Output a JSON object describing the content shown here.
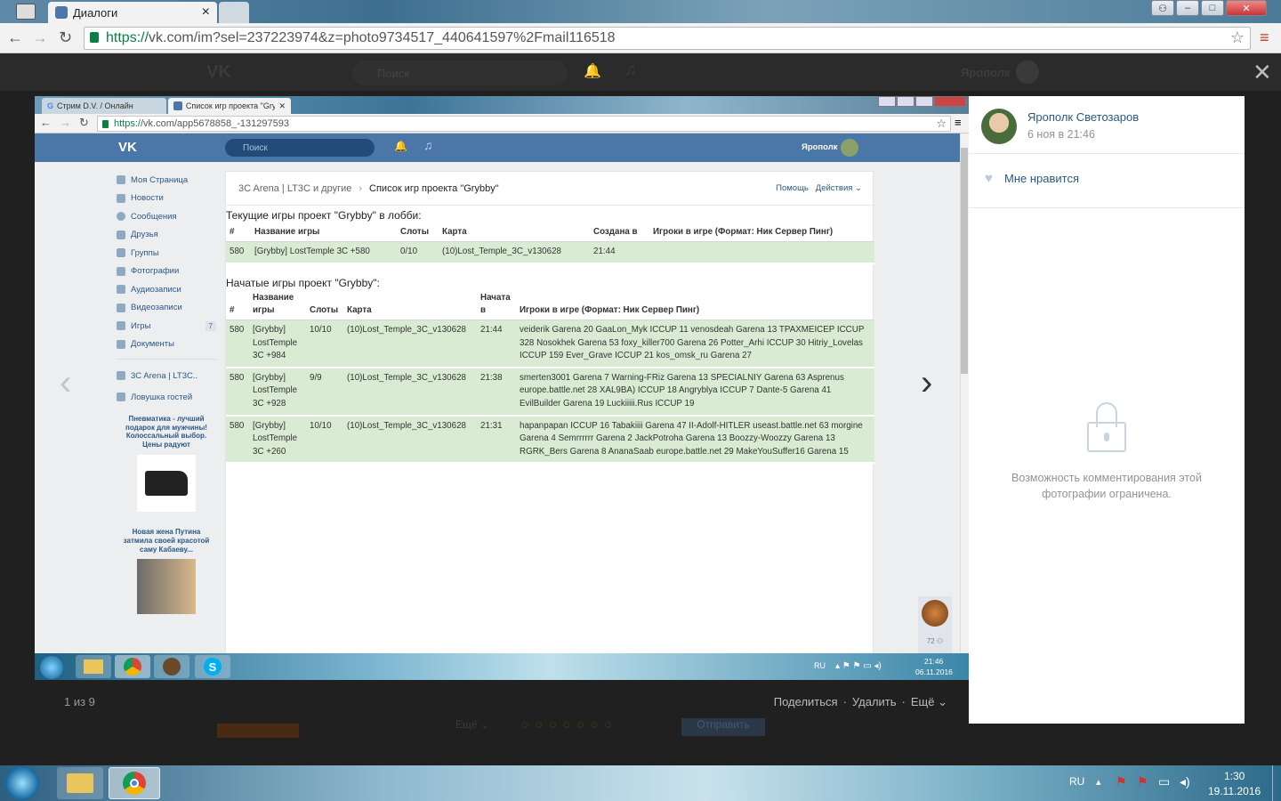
{
  "outer_browser": {
    "tab_active_title": "Диалоги",
    "tab_close": "×",
    "url_scheme": "https://",
    "url_rest": "vk.com/im?sel=237223974&z=photo9734517_440641597%2Fmail116518",
    "window_buttons": [
      "–",
      "□",
      "✕"
    ]
  },
  "vk_dark_header": {
    "search_placeholder": "Поиск",
    "user_name": "Ярополк"
  },
  "inner_screenshot": {
    "tabs": [
      {
        "title": "Стрим D.V. / Онлайн"
      },
      {
        "title": "Список игр проекта \"Gry"
      }
    ],
    "url_scheme": "https://",
    "url_rest": "vk.com/app5678858_-131297593",
    "search_placeholder": "Поиск",
    "user_name": "Ярополк",
    "sidebar": [
      {
        "label": "Моя Страница"
      },
      {
        "label": "Новости"
      },
      {
        "label": "Сообщения"
      },
      {
        "label": "Друзья"
      },
      {
        "label": "Группы"
      },
      {
        "label": "Фотографии"
      },
      {
        "label": "Аудиозаписи"
      },
      {
        "label": "Видеозаписи"
      },
      {
        "label": "Игры",
        "badge": "7"
      },
      {
        "label": "Документы"
      }
    ],
    "sidebar_extra": [
      {
        "label": "3C Arena | LT3C.."
      },
      {
        "label": "Ловушка гостей"
      }
    ],
    "ad1": "Пневматика - лучший подарок для мужчины! Колоссальный выбор. Цены радуют",
    "ad2": "Новая жена Путина затмила своей красотой саму Кабаеву...",
    "breadcrumb": {
      "group": "3C Arena | LT3C и другие",
      "sep": "›",
      "page": "Список игр проекта \"Grybby\"",
      "help": "Помощь",
      "actions": "Действия ⌄"
    },
    "lobby": {
      "title": "Текущие игры проект \"Grybby\" в лобби:",
      "headers": [
        "#",
        "Название игры",
        "Слоты",
        "Карта",
        "Создана в",
        "Игроки в игре (Формат: Ник Сервер Пинг)"
      ],
      "rows": [
        [
          "580",
          "[Grybby] LostTemple 3C +580",
          "0/10",
          "(10)Lost_Temple_3C_v130628",
          "21:44",
          ""
        ]
      ]
    },
    "started": {
      "title": "Начатые игры проект \"Grybby\":",
      "headers": [
        "#",
        "Название игры",
        "Слоты",
        "Карта",
        "Начата в",
        "Игроки в игре (Формат: Ник Сервер Пинг)"
      ],
      "rows": [
        [
          "580",
          "[Grybby] LostTemple 3C +984",
          "10/10",
          "(10)Lost_Temple_3C_v130628",
          "21:44",
          "veiderik Garena 20 GaaLon_Myk ICCUP 11 venosdeah Garena 13 TPAXMEICEP ICCUP 328 Nosokhek Garena 53 foxy_killer700 Garena 26 Potter_Arhi ICCUP 30 Hitriy_Lovelas ICCUP 159 Ever_Grave ICCUP 21 kos_omsk_ru Garena 27"
        ],
        [
          "580",
          "[Grybby] LostTemple 3C +928",
          "9/9",
          "(10)Lost_Temple_3C_v130628",
          "21:38",
          "smerten3001 Garena 7 Warning-FRiz Garena 13 SPECIALNIY Garena 63 Asprenus europe.battle.net 28 XAL9BA) ICCUP 18 Angryblya ICCUP 7 Dante-5 Garena 41 EvilBuilder Garena 19 Luckiiiii.Rus ICCUP 19"
        ],
        [
          "580",
          "[Grybby] LostTemple 3C +260",
          "10/10",
          "(10)Lost_Temple_3C_v130628",
          "21:31",
          "hapanpapan ICCUP 16 Tabakiiii Garena 47 II-Adolf-HITLER useast.battle.net 63 morgine Garena 4 Semrrrrrr Garena 2 JackPotroha Garena 13 Boozzy-Woozzy Garena 13 RGRK_Bers Garena 8 AnanaSaab europe.battle.net 29 MakeYouSuffer16 Garena 15"
        ]
      ]
    },
    "online_count": "72 ⚇",
    "taskbar": {
      "lang": "RU",
      "time": "21:46",
      "date": "06.11.2016"
    }
  },
  "photo_nav": {
    "counter": "1 из 9",
    "share": "Поделиться",
    "delete": "Удалить",
    "more": "Ещё ⌄",
    "dot": "·"
  },
  "panel": {
    "author": "Ярополк Светозаров",
    "date": "6 ноя в 21:46",
    "like": "Мне нравится",
    "comments_locked": "Возможность комментирования этой фотографии ограничена."
  },
  "behind": {
    "more": "Ещё ⌄",
    "send": "Отправить"
  },
  "taskbar": {
    "lang": "RU",
    "time": "1:30",
    "date": "19.11.2016"
  }
}
